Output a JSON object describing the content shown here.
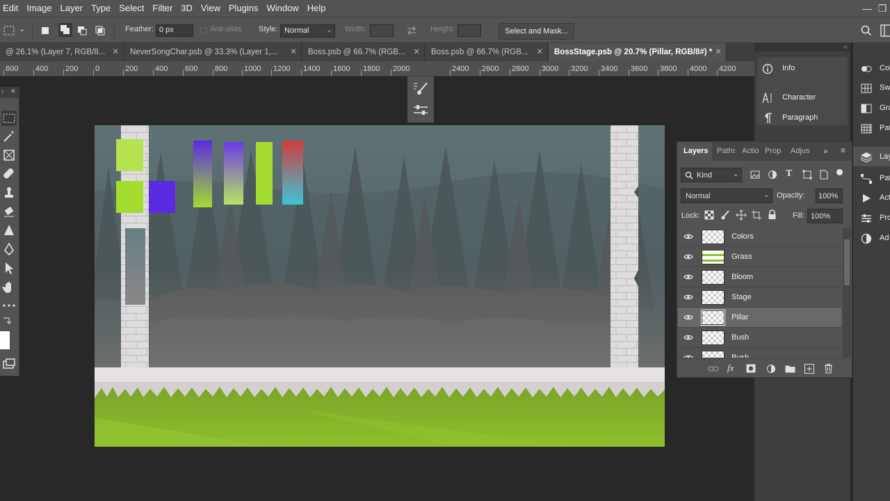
{
  "menu": [
    "Edit",
    "Image",
    "Layer",
    "Type",
    "Select",
    "Filter",
    "3D",
    "View",
    "Plugins",
    "Window",
    "Help"
  ],
  "window_controls": {
    "minimize": "—",
    "maximize": "❐",
    "close": "✕"
  },
  "options": {
    "feather_label": "Feather:",
    "feather_value": "0 px",
    "antialias_label": "Anti-alias",
    "style_label": "Style:",
    "style_value": "Normal",
    "width_label": "Width:",
    "height_label": "Height:",
    "select_mask_label": "Select and Mask..."
  },
  "tabs": [
    {
      "label": "@ 26.1% (Layer 7, RGB/8..."
    },
    {
      "label": "NeverSongChar.psb @ 33.3% (Layer 1,..."
    },
    {
      "label": "Boss.psb @ 66.7% (RGB..."
    },
    {
      "label": "Boss.psb @ 66.7% (RGB..."
    },
    {
      "label": "BossStage.psb @ 20.7% (Pillar, RGB/8#) *"
    }
  ],
  "tab_close": "✕",
  "ruler_labels": [
    "600",
    "400",
    "200",
    "0",
    "200",
    "400",
    "600",
    "800",
    "1000",
    "1200",
    "1400",
    "1600",
    "1800",
    "2000",
    "2400",
    "2600",
    "2800",
    "3000",
    "3200",
    "3400",
    "3600",
    "3800",
    "4000",
    "4200"
  ],
  "right_dock_a": [
    {
      "label": "Info",
      "icon": "info-icon"
    },
    {
      "label": "Character",
      "icon": "character-icon"
    },
    {
      "label": "Paragraph",
      "icon": "paragraph-icon"
    }
  ],
  "right_dock_b": [
    {
      "label": "Col",
      "icon": "color-icon"
    },
    {
      "label": "Sw",
      "icon": "swatches-icon"
    },
    {
      "label": "Gra",
      "icon": "gradients-icon"
    },
    {
      "label": "Pat",
      "icon": "patterns-icon"
    },
    {
      "label": "Lay",
      "icon": "layers-icon"
    },
    {
      "label": "Pat",
      "icon": "paths-icon"
    },
    {
      "label": "Act",
      "icon": "actions-icon"
    },
    {
      "label": "Pro",
      "icon": "properties-icon"
    },
    {
      "label": "Ad",
      "icon": "adjustments-icon"
    }
  ],
  "layers_panel": {
    "tabs": [
      "Layers",
      "Paths",
      "Actio",
      "Prop",
      "Adjus"
    ],
    "kind_label": "Kind",
    "blend_mode": "Normal",
    "opacity_label": "Opacity:",
    "opacity_value": "100%",
    "lock_label": "Lock:",
    "fill_label": "Fill:",
    "fill_value": "100%",
    "layers": [
      {
        "name": "Colors",
        "selected": false
      },
      {
        "name": "Grass",
        "selected": false
      },
      {
        "name": "Bloom",
        "selected": false
      },
      {
        "name": "Stage",
        "selected": false
      },
      {
        "name": "Pillar",
        "selected": true
      },
      {
        "name": "Bush",
        "selected": false
      },
      {
        "name": "Bush",
        "selected": false
      }
    ]
  },
  "colors": {
    "ui_bg": "#535353",
    "canvas_sky": "#5c6f72",
    "grass": "#8cbf2b",
    "swatch_green": "#a4dc2f",
    "swatch_violet": "#5a2be0"
  }
}
